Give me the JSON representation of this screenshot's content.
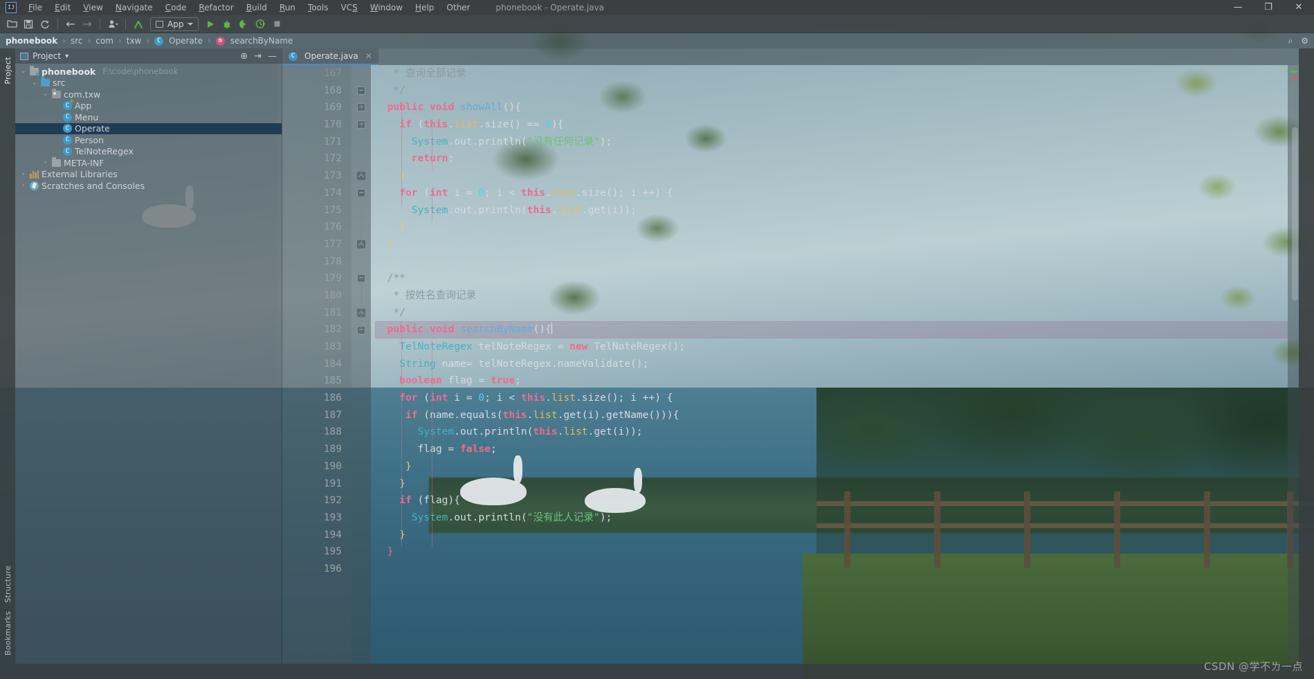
{
  "window": {
    "title": "phonebook - Operate.java",
    "minimize": "—",
    "maximize": "❐",
    "close": "✕"
  },
  "menubar": {
    "logo": "IJ",
    "items": [
      "File",
      "Edit",
      "View",
      "Navigate",
      "Code",
      "Refactor",
      "Build",
      "Run",
      "Tools",
      "VCS",
      "Window",
      "Help",
      "Other"
    ]
  },
  "toolbar": {
    "open_label": "open-folder",
    "save_label": "save",
    "sync_label": "sync",
    "back_label": "←",
    "forward_label": "→",
    "profile_label": "user",
    "update_label": "update-project",
    "run_config": "App",
    "run_label": "run",
    "debug_label": "debug",
    "coverage_label": "run-with-coverage",
    "profiler_label": "profiler",
    "stop_label": "stop"
  },
  "breadcrumbs": {
    "items": [
      {
        "label": "phonebook",
        "icon": "",
        "strong": true
      },
      {
        "label": "src",
        "icon": ""
      },
      {
        "label": "com",
        "icon": ""
      },
      {
        "label": "txw",
        "icon": ""
      },
      {
        "label": "Operate",
        "icon": "C"
      },
      {
        "label": "searchByName",
        "icon": "m"
      }
    ],
    "search_icon": "⌕",
    "settings_icon": "⚙"
  },
  "left_strip": {
    "top": "Project",
    "bottom_items": [
      "Structure",
      "Bookmarks"
    ]
  },
  "project_panel": {
    "title": "Project",
    "chevron": "▾",
    "locate_icon": "⊕",
    "collapse_icon": "⇥",
    "minimize_icon": "—",
    "tree": [
      {
        "depth": 0,
        "arrow": "⌄",
        "icon": "module",
        "label": "phonebook",
        "bold": true,
        "path": "F:\\code\\phonebook"
      },
      {
        "depth": 1,
        "arrow": "⌄",
        "icon": "folder-blue",
        "label": "src",
        "bold": false,
        "path": ""
      },
      {
        "depth": 2,
        "arrow": "⌄",
        "icon": "package",
        "label": "com.txw",
        "bold": false,
        "path": ""
      },
      {
        "depth": 3,
        "arrow": "",
        "icon": "class-run",
        "label": "App",
        "bold": false,
        "path": ""
      },
      {
        "depth": 3,
        "arrow": "",
        "icon": "class",
        "label": "Menu",
        "bold": false,
        "path": ""
      },
      {
        "depth": 3,
        "arrow": "",
        "icon": "class",
        "label": "Operate",
        "bold": false,
        "path": "",
        "selected": true
      },
      {
        "depth": 3,
        "arrow": "",
        "icon": "class",
        "label": "Person",
        "bold": false,
        "path": ""
      },
      {
        "depth": 3,
        "arrow": "",
        "icon": "class",
        "label": "TelNoteRegex",
        "bold": false,
        "path": ""
      },
      {
        "depth": 2,
        "arrow": "›",
        "icon": "folder",
        "label": "META-INF",
        "bold": false,
        "path": ""
      },
      {
        "depth": 0,
        "arrow": "›",
        "icon": "library",
        "label": "External Libraries",
        "bold": false,
        "path": ""
      },
      {
        "depth": 0,
        "arrow": "›",
        "icon": "scratch",
        "label": "Scratches and Consoles",
        "bold": false,
        "path": ""
      }
    ]
  },
  "editor": {
    "tabs": [
      {
        "label": "Operate.java",
        "icon": "C",
        "close": "✕",
        "active": true
      }
    ],
    "first_line": 167,
    "current_line": 182,
    "lines": [
      {
        "n": 167,
        "clipped": true,
        "tokens": [
          {
            "t": "   * 查询全部记录",
            "c": "cmt"
          }
        ]
      },
      {
        "n": 168,
        "tokens": [
          {
            "t": "   */",
            "c": "cmt"
          }
        ]
      },
      {
        "n": 169,
        "tokens": [
          {
            "t": "  ",
            "c": "punct"
          },
          {
            "t": "public",
            "c": "kw"
          },
          {
            "t": " ",
            "c": "punct"
          },
          {
            "t": "void",
            "c": "kw"
          },
          {
            "t": " ",
            "c": "punct"
          },
          {
            "t": "showAll",
            "c": "meth"
          },
          {
            "t": "(){",
            "c": "punct"
          }
        ]
      },
      {
        "n": 170,
        "tokens": [
          {
            "t": "    ",
            "c": "punct"
          },
          {
            "t": "if",
            "c": "kw"
          },
          {
            "t": " (",
            "c": "punct"
          },
          {
            "t": "this",
            "c": "kw"
          },
          {
            "t": ".",
            "c": "punct"
          },
          {
            "t": "list",
            "c": "field"
          },
          {
            "t": ".size() ",
            "c": "punct"
          },
          {
            "t": "==",
            "c": "punct"
          },
          {
            "t": " ",
            "c": "punct"
          },
          {
            "t": "0",
            "c": "num"
          },
          {
            "t": "){",
            "c": "punct"
          }
        ]
      },
      {
        "n": 171,
        "tokens": [
          {
            "t": "      ",
            "c": "punct"
          },
          {
            "t": "System",
            "c": "type"
          },
          {
            "t": ".out.println(",
            "c": "punct"
          },
          {
            "t": "\"没有任何记录\"",
            "c": "str"
          },
          {
            "t": ");",
            "c": "punct"
          }
        ]
      },
      {
        "n": 172,
        "tokens": [
          {
            "t": "      ",
            "c": "punct"
          },
          {
            "t": "return",
            "c": "kw"
          },
          {
            "t": ";",
            "c": "punct"
          }
        ]
      },
      {
        "n": 173,
        "tokens": [
          {
            "t": "    ",
            "c": "punct"
          },
          {
            "t": "}",
            "c": "brace"
          }
        ]
      },
      {
        "n": 174,
        "tokens": [
          {
            "t": "    ",
            "c": "punct"
          },
          {
            "t": "for",
            "c": "kw"
          },
          {
            "t": " (",
            "c": "punct"
          },
          {
            "t": "int",
            "c": "kw"
          },
          {
            "t": " i = ",
            "c": "punct"
          },
          {
            "t": "0",
            "c": "num"
          },
          {
            "t": "; i < ",
            "c": "punct"
          },
          {
            "t": "this",
            "c": "kw"
          },
          {
            "t": ".",
            "c": "punct"
          },
          {
            "t": "list",
            "c": "field"
          },
          {
            "t": ".size(); i ++) {",
            "c": "punct"
          }
        ]
      },
      {
        "n": 175,
        "tokens": [
          {
            "t": "      ",
            "c": "punct"
          },
          {
            "t": "System",
            "c": "type"
          },
          {
            "t": ".out.println(",
            "c": "punct"
          },
          {
            "t": "this",
            "c": "kw"
          },
          {
            "t": ".",
            "c": "punct"
          },
          {
            "t": "list",
            "c": "field"
          },
          {
            "t": ".get(i));",
            "c": "punct"
          }
        ]
      },
      {
        "n": 176,
        "tokens": [
          {
            "t": "    ",
            "c": "punct"
          },
          {
            "t": "}",
            "c": "brace"
          }
        ]
      },
      {
        "n": 177,
        "tokens": [
          {
            "t": "  ",
            "c": "punct"
          },
          {
            "t": "}",
            "c": "brace"
          }
        ]
      },
      {
        "n": 178,
        "tokens": [
          {
            "t": "",
            "c": "punct"
          }
        ]
      },
      {
        "n": 179,
        "tokens": [
          {
            "t": "  /**",
            "c": "cmt"
          }
        ]
      },
      {
        "n": 180,
        "tokens": [
          {
            "t": "   * 按姓名查询记录",
            "c": "cmt"
          }
        ]
      },
      {
        "n": 181,
        "tokens": [
          {
            "t": "   */",
            "c": "cmt"
          }
        ]
      },
      {
        "n": 182,
        "current": true,
        "caret": true,
        "tokens": [
          {
            "t": "  ",
            "c": "punct"
          },
          {
            "t": "public",
            "c": "kw"
          },
          {
            "t": " ",
            "c": "punct"
          },
          {
            "t": "void",
            "c": "kw"
          },
          {
            "t": " ",
            "c": "punct"
          },
          {
            "t": "searchByName",
            "c": "meth"
          },
          {
            "t": "(){",
            "c": "punct"
          }
        ]
      },
      {
        "n": 183,
        "tokens": [
          {
            "t": "    ",
            "c": "punct"
          },
          {
            "t": "TelNoteRegex",
            "c": "type"
          },
          {
            "t": " telNoteRegex = ",
            "c": "punct"
          },
          {
            "t": "new",
            "c": "kw"
          },
          {
            "t": " TelNoteRegex();",
            "c": "punct"
          }
        ]
      },
      {
        "n": 184,
        "tokens": [
          {
            "t": "    ",
            "c": "punct"
          },
          {
            "t": "String",
            "c": "type"
          },
          {
            "t": " name= telNoteRegex.nameValidate();",
            "c": "punct"
          }
        ]
      },
      {
        "n": 185,
        "tokens": [
          {
            "t": "    ",
            "c": "punct"
          },
          {
            "t": "boolean",
            "c": "kw"
          },
          {
            "t": " flag = ",
            "c": "punct"
          },
          {
            "t": "true",
            "c": "kw"
          },
          {
            "t": ";",
            "c": "punct"
          }
        ]
      },
      {
        "n": 186,
        "tokens": [
          {
            "t": "    ",
            "c": "punct"
          },
          {
            "t": "for",
            "c": "kw"
          },
          {
            "t": " (",
            "c": "punct"
          },
          {
            "t": "int",
            "c": "kw"
          },
          {
            "t": " i = ",
            "c": "punct"
          },
          {
            "t": "0",
            "c": "num"
          },
          {
            "t": "; i < ",
            "c": "punct"
          },
          {
            "t": "this",
            "c": "kw"
          },
          {
            "t": ".",
            "c": "punct"
          },
          {
            "t": "list",
            "c": "field"
          },
          {
            "t": ".size(); i ++) {",
            "c": "punct"
          }
        ]
      },
      {
        "n": 187,
        "tokens": [
          {
            "t": "     ",
            "c": "punct"
          },
          {
            "t": "if",
            "c": "kw"
          },
          {
            "t": " (name.equals(",
            "c": "punct"
          },
          {
            "t": "this",
            "c": "kw"
          },
          {
            "t": ".",
            "c": "punct"
          },
          {
            "t": "list",
            "c": "field"
          },
          {
            "t": ".get(i).getName())){",
            "c": "punct"
          }
        ]
      },
      {
        "n": 188,
        "tokens": [
          {
            "t": "       ",
            "c": "punct"
          },
          {
            "t": "System",
            "c": "type"
          },
          {
            "t": ".out.println(",
            "c": "punct"
          },
          {
            "t": "this",
            "c": "kw"
          },
          {
            "t": ".",
            "c": "punct"
          },
          {
            "t": "list",
            "c": "field"
          },
          {
            "t": ".get(i));",
            "c": "punct"
          }
        ]
      },
      {
        "n": 189,
        "tokens": [
          {
            "t": "       flag = ",
            "c": "punct"
          },
          {
            "t": "false",
            "c": "kw"
          },
          {
            "t": ";",
            "c": "punct"
          }
        ]
      },
      {
        "n": 190,
        "tokens": [
          {
            "t": "     ",
            "c": "punct"
          },
          {
            "t": "}",
            "c": "brace"
          }
        ]
      },
      {
        "n": 191,
        "tokens": [
          {
            "t": "    ",
            "c": "punct"
          },
          {
            "t": "}",
            "c": "brace"
          }
        ]
      },
      {
        "n": 192,
        "tokens": [
          {
            "t": "    ",
            "c": "punct"
          },
          {
            "t": "if",
            "c": "kw"
          },
          {
            "t": " (flag){",
            "c": "punct"
          }
        ]
      },
      {
        "n": 193,
        "tokens": [
          {
            "t": "      ",
            "c": "punct"
          },
          {
            "t": "System",
            "c": "type"
          },
          {
            "t": ".out.println(",
            "c": "punct"
          },
          {
            "t": "\"没有此人记录\"",
            "c": "str"
          },
          {
            "t": ");",
            "c": "punct"
          }
        ]
      },
      {
        "n": 194,
        "tokens": [
          {
            "t": "    ",
            "c": "punct"
          },
          {
            "t": "}",
            "c": "brace"
          }
        ]
      },
      {
        "n": 195,
        "tokens": [
          {
            "t": "  ",
            "c": "punct"
          },
          {
            "t": "}",
            "c": "kw2"
          }
        ]
      },
      {
        "n": 196,
        "tokens": [
          {
            "t": "",
            "c": "punct"
          }
        ]
      }
    ]
  },
  "right_strip": {
    "items": []
  },
  "watermark": {
    "text": "CSDN @学不ㄌ一点"
  },
  "colors": {
    "accent": "#4a88c7",
    "keyword": "#ef6b8f",
    "method": "#6aa8d8",
    "field": "#e8b960",
    "number": "#4fd4e8",
    "string": "#6ec07a",
    "comment": "#8d9a9e",
    "selection": "#1f3c55",
    "current_line": "#96 6e8c"
  }
}
